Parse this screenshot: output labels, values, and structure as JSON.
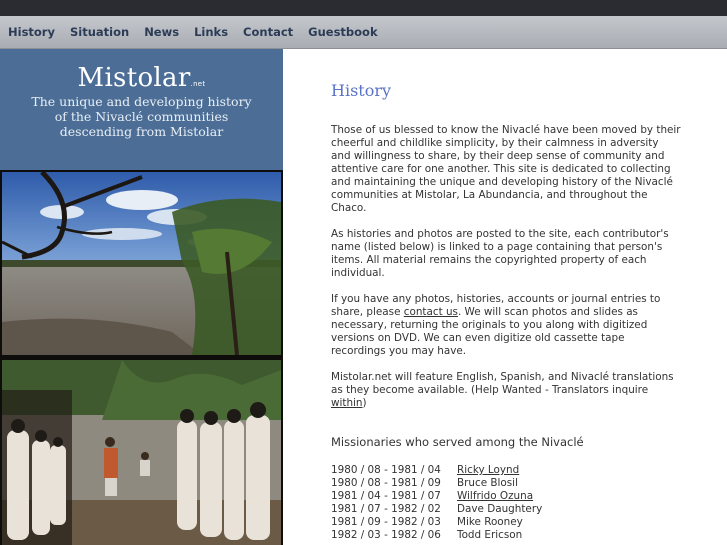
{
  "nav": {
    "items": [
      "History",
      "Situation",
      "News",
      "Links",
      "Contact",
      "Guestbook"
    ]
  },
  "brand": {
    "title": "Mistolar",
    "suffix": ".net",
    "tagline_1": "The unique and developing history",
    "tagline_2": "of the Nivaclé communities",
    "tagline_3": "descending from Mistolar"
  },
  "main": {
    "heading": "History",
    "p1": "Those of us blessed to know the Nivaclé have been moved by their cheerful and childlike simplicity, by their calmness in adversity and willingness to share, by their deep sense of community and attentive care for one another.  This site is dedicated to collecting and maintaining the unique and developing history of the Nivaclé communities at Mistolar, La Abundancia, and throughout the Chaco.",
    "p2": "As histories and photos are posted to the site, each contributor's name (listed below) is linked to a page containing that person's items.  All material remains the copyrighted property of each individual.",
    "p3_before": "If you have any photos, histories, accounts or journal entries to share, please ",
    "p3_link": "contact us",
    "p3_after": ".  We will scan photos and slides as necessary, returning the originals to you along with digitized versions on DVD.  We can even digitize old cassette tape recordings you may have.",
    "p4_before": "Mistolar.net will feature English, Spanish, and Nivaclé translations as they become available.  (Help Wanted - Translators inquire ",
    "p4_link": "within",
    "p4_after": ")",
    "missionaries_heading": "Missionaries who served among the Nivaclé",
    "missionaries": [
      {
        "dates": "1980 / 08  -  1981 / 04",
        "name": "Ricky Loynd",
        "link": true
      },
      {
        "dates": "1980 / 08  -  1981 / 09",
        "name": "Bruce Blosil",
        "link": false
      },
      {
        "dates": "1981 / 04  -  1981 / 07",
        "name": "Wilfrido Ozuna",
        "link": true
      },
      {
        "dates": "1981 / 07  -  1982 / 02",
        "name": "Dave Daughtery",
        "link": false
      },
      {
        "dates": "1981 / 09  -  1982 / 03",
        "name": "Mike Rooney",
        "link": false
      },
      {
        "dates": "1982 / 03  -  1982 / 06",
        "name": "Todd Ericson",
        "link": false
      }
    ]
  }
}
